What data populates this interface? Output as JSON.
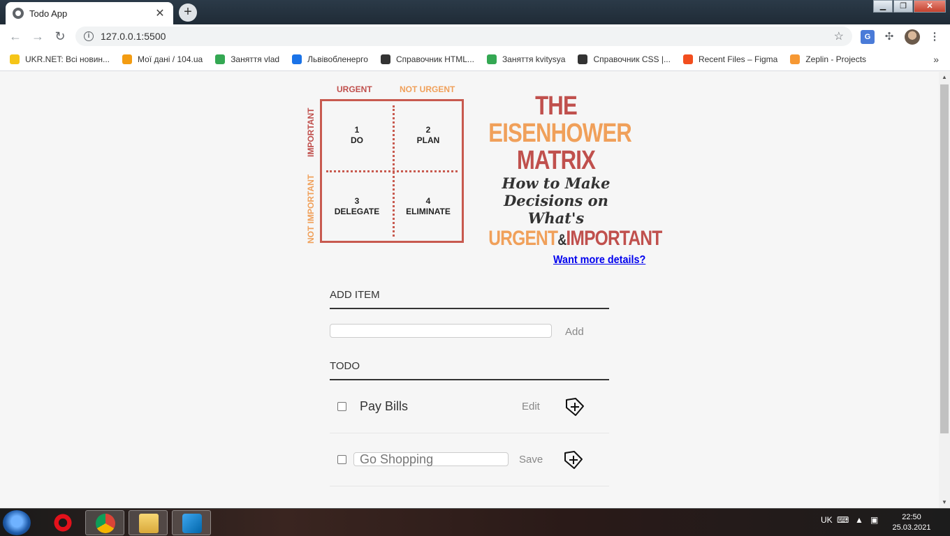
{
  "browser": {
    "tab_title": "Todo App",
    "tab_close": "✕",
    "new_tab": "+",
    "url": "127.0.0.1:5500",
    "bookmarks": [
      {
        "label": "UKR.NET: Всі новин...",
        "color": "#f5c518"
      },
      {
        "label": "Мої дані / 104.ua",
        "color": "#f39c12"
      },
      {
        "label": "Заняття vlad",
        "color": "#34a853"
      },
      {
        "label": "Львівобленерго",
        "color": "#1a73e8"
      },
      {
        "label": "Справочник HTML...",
        "color": "#333333"
      },
      {
        "label": "Заняття kvitysya",
        "color": "#34a853"
      },
      {
        "label": "Справочник CSS |...",
        "color": "#333333"
      },
      {
        "label": "Recent Files – Figma",
        "color": "#f24e1e"
      },
      {
        "label": "Zeplin - Projects",
        "color": "#f69833"
      }
    ],
    "bookmarks_more": "»"
  },
  "matrix": {
    "urgent": "URGENT",
    "not_urgent": "NOT URGENT",
    "important": "IMPORTANT",
    "not_important": "NOT IMPORTANT",
    "q1_num": "1",
    "q1_label": "DO",
    "q2_num": "2",
    "q2_label": "PLAN",
    "q3_num": "3",
    "q3_label": "DELEGATE",
    "q4_num": "4",
    "q4_label": "ELIMINATE",
    "title_the": "THE",
    "title_eisenhower": "EISENHOWER",
    "title_matrix": "MATRIX",
    "subtitle_1": "How to Make",
    "subtitle_2": "Decisions on What's",
    "urgent_word": "URGENT",
    "amp": "&",
    "important_word": "IMPORTANT",
    "colors": {
      "red": "#c0504d",
      "orange": "#f0a05a"
    }
  },
  "details_link": "Want more details?",
  "add_section": {
    "title": "ADD ITEM",
    "input_value": "",
    "button": "Add"
  },
  "todo_section": {
    "title": "TODO",
    "items": [
      {
        "text": "Pay Bills",
        "action": "Edit",
        "checked": false,
        "editing": false
      },
      {
        "text": "Go Shopping",
        "action": "Save",
        "checked": false,
        "editing": true
      }
    ]
  },
  "taskbar": {
    "lang": "UK",
    "time": "22:50",
    "date": "25.03.2021"
  }
}
